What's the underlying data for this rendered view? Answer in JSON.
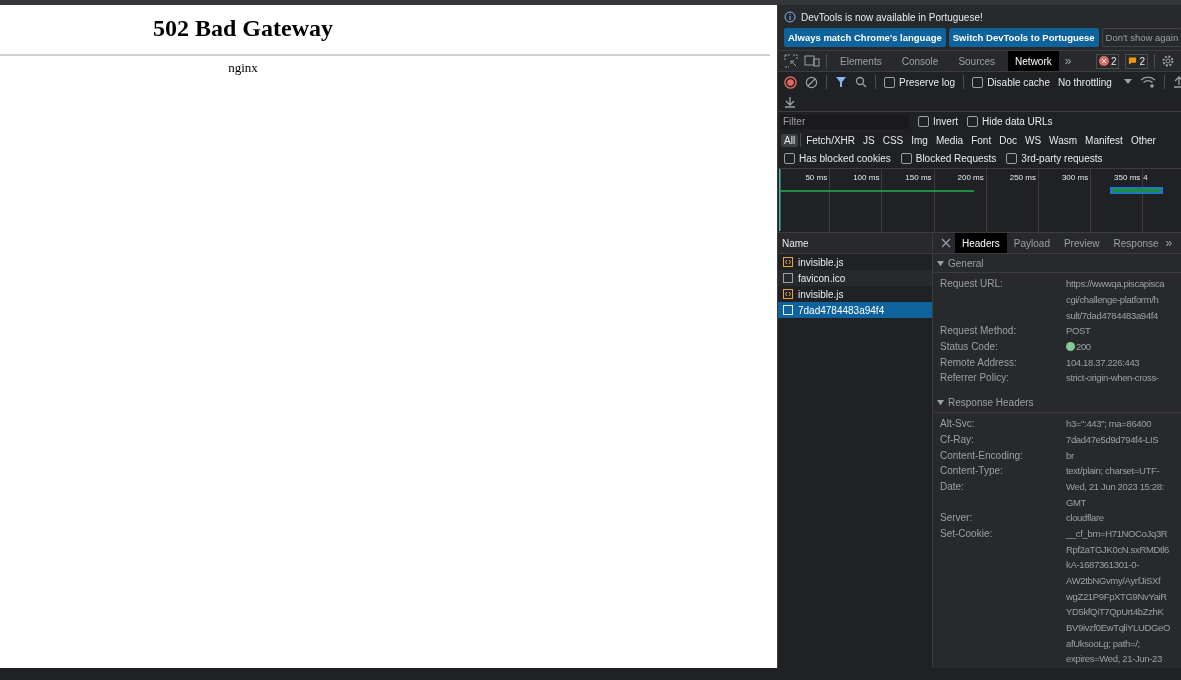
{
  "page": {
    "heading": "502 Bad Gateway",
    "footer": "nginx"
  },
  "devtools": {
    "banner": {
      "message": "DevTools is now available in Portuguese!",
      "buttons": [
        {
          "label": "Always match Chrome's language",
          "kind": "primary"
        },
        {
          "label": "Switch DevTools to Portuguese",
          "kind": "primary"
        },
        {
          "label": "Don't show again",
          "kind": "secondary"
        }
      ]
    },
    "tabs": [
      {
        "label": "Elements",
        "selected": false
      },
      {
        "label": "Console",
        "selected": false
      },
      {
        "label": "Sources",
        "selected": false
      },
      {
        "label": "Network",
        "selected": true
      }
    ],
    "more_tabs": "»",
    "error_count": "2",
    "warning_count": "2",
    "toolbar": {
      "preserve_log": {
        "label": "Preserve log",
        "checked": false
      },
      "disable_cache": {
        "label": "Disable cache",
        "checked": false
      },
      "throttling": "No throttling"
    },
    "filter": {
      "placeholder": "Filter",
      "options": [
        {
          "label": "Invert",
          "checked": false
        },
        {
          "label": "Hide data URLs",
          "checked": false
        }
      ]
    },
    "types": [
      {
        "label": "All",
        "selected": true
      },
      {
        "label": "Fetch/XHR",
        "selected": false
      },
      {
        "label": "JS",
        "selected": false
      },
      {
        "label": "CSS",
        "selected": false
      },
      {
        "label": "Img",
        "selected": false
      },
      {
        "label": "Media",
        "selected": false
      },
      {
        "label": "Font",
        "selected": false
      },
      {
        "label": "Doc",
        "selected": false
      },
      {
        "label": "WS",
        "selected": false
      },
      {
        "label": "Wasm",
        "selected": false
      },
      {
        "label": "Manifest",
        "selected": false
      },
      {
        "label": "Other",
        "selected": false
      }
    ],
    "blocked_filters": [
      {
        "label": "Has blocked cookies",
        "checked": false
      },
      {
        "label": "Blocked Requests",
        "checked": false
      },
      {
        "label": "3rd-party requests",
        "checked": false
      }
    ],
    "timeline_ticks": [
      "50 ms",
      "100 ms",
      "150 ms",
      "200 ms",
      "250 ms",
      "300 ms",
      "350 ms",
      "4"
    ],
    "name_column": "Name",
    "requests": [
      {
        "name": "invisible.js",
        "kind": "script",
        "selected": false
      },
      {
        "name": "favicon.ico",
        "kind": "document",
        "selected": false
      },
      {
        "name": "invisible.js",
        "kind": "script",
        "selected": false
      },
      {
        "name": "7dad4784483a94f4",
        "kind": "document",
        "selected": true
      }
    ],
    "detail_tabs": [
      {
        "label": "Headers",
        "selected": true
      },
      {
        "label": "Payload",
        "selected": false
      },
      {
        "label": "Preview",
        "selected": false
      },
      {
        "label": "Response",
        "selected": false
      }
    ],
    "sections": [
      {
        "title": "General",
        "expanded": true,
        "rows": [
          {
            "key": "Request URL:",
            "lines": [
              "https://wwwqa.piscapisca",
              "cgi/challenge-platform/h",
              "sult/7dad4784483a94f4"
            ]
          },
          {
            "key": "Request Method:",
            "lines": [
              "POST"
            ]
          },
          {
            "key": "Status Code:",
            "lines": [
              "200"
            ],
            "color": "#81c995"
          },
          {
            "key": "Remote Address:",
            "lines": [
              "104.18.37.226:443"
            ]
          },
          {
            "key": "Referrer Policy:",
            "lines": [
              "strict-origin-when-cross-"
            ]
          }
        ]
      },
      {
        "title": "Response Headers",
        "expanded": true,
        "rows": [
          {
            "key": "Alt-Svc:",
            "lines": [
              "h3=\":443\"; ma=86400"
            ]
          },
          {
            "key": "Cf-Ray:",
            "lines": [
              "7dad47e5d9d794f4-LIS"
            ]
          },
          {
            "key": "Content-Encoding:",
            "lines": [
              "br"
            ]
          },
          {
            "key": "Content-Type:",
            "lines": [
              "text/plain; charset=UTF-"
            ]
          },
          {
            "key": "Date:",
            "lines": [
              "Wed, 21 Jun 2023 15:28:",
              "GMT"
            ]
          },
          {
            "key": "Server:",
            "lines": [
              "cloudflare"
            ]
          },
          {
            "key": "Set-Cookie:",
            "lines": [
              "__cf_bm=H71NOCoJq3R",
              "Rpf2aTGJK0cN.sxRMDtl6",
              "kA-1687361301-0-",
              "AW2tbNGvmy/AyrfJiSXf",
              "wgZ21P9FpXTG9NvYaiR",
              "YD5kfQiT7QpUrt4bZzhK",
              "BV9ivzf0EwTqliYLUDGeO",
              "afUksooLg; path=/;",
              "expires=Wed, 21-Jun-23"
            ]
          }
        ]
      }
    ]
  }
}
